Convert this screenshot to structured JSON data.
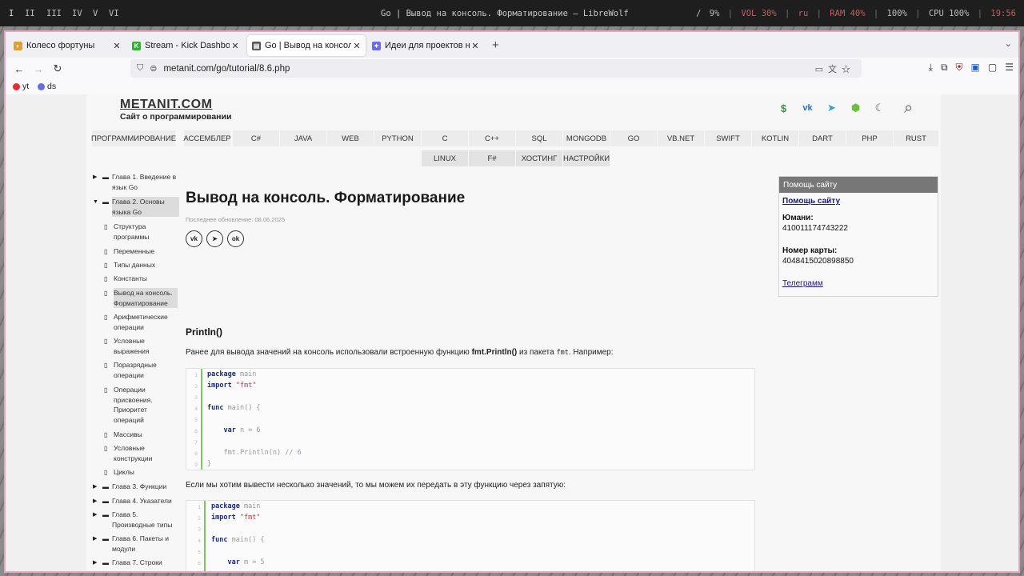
{
  "system_bar": {
    "workspaces": [
      "I",
      "II",
      "III",
      "IV",
      "V",
      "VI"
    ],
    "window_title": "Go | Вывод на консоль. Форматирование — LibreWolf",
    "stats": [
      "/",
      "9%",
      "|",
      "VOL 30%",
      "|",
      "ru",
      "|",
      "RAM 40%",
      "|",
      "100%",
      "|",
      "CPU 100%",
      "|",
      "19:56"
    ]
  },
  "browser": {
    "tabs": [
      {
        "label": "Колесо фортуны",
        "favicon": "wheel-icon",
        "color": "#e0a030"
      },
      {
        "label": "Stream - Kick Dashboar",
        "favicon": "kick-icon",
        "color": "#2db52d"
      },
      {
        "label": "Go | Вывод на консоль",
        "favicon": "page-icon",
        "color": "#444444"
      },
      {
        "label": "Идеи для проектов на С",
        "favicon": "ai-icon",
        "color": "#6a6aee"
      }
    ],
    "new_tab": "+",
    "url": "metanit.com/go/tutorial/8.6.php",
    "bookmarks": [
      {
        "label": "yt",
        "color": "#e03030"
      },
      {
        "label": "ds",
        "color": "#6070e0"
      }
    ]
  },
  "site": {
    "logo": "METANIT.COM",
    "tagline": "Сайт о программировании",
    "header_icons": [
      "dollar-icon",
      "vk-icon",
      "telegram-icon",
      "android-icon",
      "moon-icon"
    ],
    "menu_row1": [
      "ПРОГРАММИРОВАНИЕ",
      "АССЕМБЛЕР",
      "C#",
      "JAVA",
      "WEB",
      "PYTHON",
      "C",
      "C++",
      "SQL",
      "MONGODB",
      "GO",
      "VB.NET",
      "SWIFT",
      "KOTLIN",
      "DART",
      "PHP",
      "RUST"
    ],
    "menu_row2": [
      "LINUX",
      "F#",
      "ХОСТИНГ",
      "НАСТРОЙКИ"
    ]
  },
  "sidebar": [
    {
      "text": "Глава 1. Введение в\nязык Go",
      "type": "folder"
    },
    {
      "text": "Глава 2. Основы\nязыка Go",
      "type": "folder-open"
    },
    {
      "text": "Структура\nпрограммы",
      "type": "page"
    },
    {
      "text": "Переменные",
      "type": "page"
    },
    {
      "text": "Типы данных",
      "type": "page"
    },
    {
      "text": "Константы",
      "type": "page"
    },
    {
      "text": "Вывод на консоль.\nФорматирование",
      "type": "page"
    },
    {
      "text": "Арифметические\nоперации",
      "type": "page"
    },
    {
      "text": "Условные\nвыражения",
      "type": "page"
    },
    {
      "text": "Поразрядные\nоперации",
      "type": "page"
    },
    {
      "text": "Операции\nприсвоения.\nПриоритет\nопераций",
      "type": "page"
    },
    {
      "text": "Массивы",
      "type": "page"
    },
    {
      "text": "Условные\nконструкции",
      "type": "page"
    },
    {
      "text": "Циклы",
      "type": "page"
    },
    {
      "text": "Глава 3. Функции",
      "type": "folder"
    },
    {
      "text": "Глава 4. Указатели",
      "type": "folder"
    },
    {
      "text": "Глава 5.\nПроизводные типы",
      "type": "folder"
    },
    {
      "text": "Глава 6. Пакеты и\nмодули",
      "type": "folder"
    },
    {
      "text": "Глава 7. Строки",
      "type": "folder"
    }
  ],
  "article": {
    "title": "Вывод на консоль. Форматирование",
    "updated": "Последнее обновление: 08.06.2025",
    "share": [
      "vk-icon",
      "telegram-icon",
      "ok-icon"
    ],
    "section_title": "Println()",
    "para1_before": "Ранее для вывода значений на консоль использовали встроенную функцию ",
    "para1_bold": "fmt.Println()",
    "para1_mid": " из пакета ",
    "para1_code": "fmt",
    "para1_after": ". Например:",
    "code1": [
      {
        "n": "1",
        "t": "package main"
      },
      {
        "n": "2",
        "t": "import \"fmt\""
      },
      {
        "n": "3",
        "t": ""
      },
      {
        "n": "4",
        "t": "func main() {"
      },
      {
        "n": "5",
        "t": ""
      },
      {
        "n": "6",
        "t": "    var n = 6"
      },
      {
        "n": "7",
        "t": ""
      },
      {
        "n": "8",
        "t": "    fmt.Println(n) // 6"
      },
      {
        "n": "9",
        "t": "}"
      }
    ],
    "para2": "Если мы хотим вывести несколько значений, то мы можем их передать в эту функцию через запятую:",
    "code2": [
      {
        "n": "1",
        "t": "package main"
      },
      {
        "n": "2",
        "t": "import \"fmt\""
      },
      {
        "n": "3",
        "t": ""
      },
      {
        "n": "4",
        "t": "func main() {"
      },
      {
        "n": "5",
        "t": ""
      },
      {
        "n": "6",
        "t": "    var m = 5"
      }
    ]
  },
  "donate": {
    "header": "Помощь сайту",
    "link": "Помощь сайту",
    "yoomoney_label": "Юмани:",
    "yoomoney_value": "410011174743222",
    "card_label": "Номер карты:",
    "card_value": "4048415020898850",
    "telegram": "Телеграмм"
  }
}
